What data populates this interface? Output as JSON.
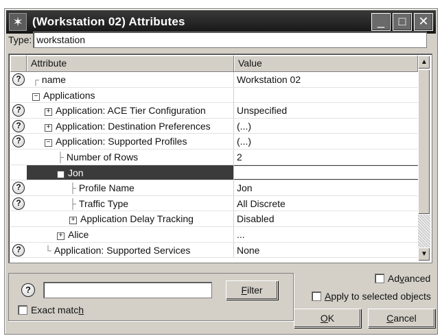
{
  "window": {
    "title": "(Workstation 02) Attributes",
    "icon": "asterisk-app-icon",
    "controls": {
      "minimize": "_",
      "maximize": "□",
      "close": "✕"
    }
  },
  "type_field": {
    "label": "Type:",
    "value": "workstation"
  },
  "grid": {
    "headers": {
      "attribute": "Attribute",
      "value": "Value"
    },
    "rows": [
      {
        "help": true,
        "indent": 0,
        "prefix": "┌ ",
        "expander": "",
        "attribute": "name",
        "value": "Workstation 02"
      },
      {
        "help": false,
        "indent": 0,
        "prefix": "",
        "expander": "−",
        "attribute": "Applications",
        "value": ""
      },
      {
        "help": true,
        "indent": 1,
        "prefix": "",
        "expander": "+",
        "attribute": "Application: ACE Tier Configuration",
        "value": "Unspecified"
      },
      {
        "help": true,
        "indent": 1,
        "prefix": "",
        "expander": "+",
        "attribute": "Application: Destination Preferences",
        "value": "(...)"
      },
      {
        "help": true,
        "indent": 1,
        "prefix": "",
        "expander": "−",
        "attribute": "Application: Supported Profiles",
        "value": "(...)"
      },
      {
        "help": false,
        "indent": 2,
        "prefix": "├ ",
        "expander": "",
        "attribute": "Number of Rows",
        "value": "2"
      },
      {
        "help": false,
        "indent": 2,
        "prefix": "",
        "expander": "−",
        "attribute": "Jon",
        "value": "",
        "selected": true
      },
      {
        "help": true,
        "indent": 3,
        "prefix": "├ ",
        "expander": "",
        "attribute": "Profile Name",
        "value": "Jon"
      },
      {
        "help": true,
        "indent": 3,
        "prefix": "├ ",
        "expander": "",
        "attribute": "Traffic Type",
        "value": "All Discrete"
      },
      {
        "help": false,
        "indent": 3,
        "prefix": "",
        "expander": "+",
        "attribute": "Application Delay Tracking",
        "value": "Disabled"
      },
      {
        "help": false,
        "indent": 2,
        "prefix": "",
        "expander": "+",
        "attribute": "Alice",
        "value": "..."
      },
      {
        "help": true,
        "indent": 1,
        "prefix": "└ ",
        "expander": "",
        "attribute": "Application: Supported Services",
        "value": "None"
      }
    ]
  },
  "scrollbar": {
    "up": "▲",
    "down": "▼"
  },
  "filter": {
    "help_glyph": "?",
    "placeholder": "",
    "button_prefix": "",
    "button_underline": "F",
    "button_rest": "ilter",
    "exact_match_prefix": "Exact matc",
    "exact_match_underline": "h",
    "exact_match_rest": ""
  },
  "options": {
    "advanced_prefix": "Ad",
    "advanced_underline": "v",
    "advanced_rest": "anced",
    "apply_prefix": "",
    "apply_underline": "A",
    "apply_rest": "pply to selected objects"
  },
  "buttons": {
    "ok_underline": "O",
    "ok_rest": "K",
    "cancel_underline": "C",
    "cancel_rest": "ancel"
  }
}
